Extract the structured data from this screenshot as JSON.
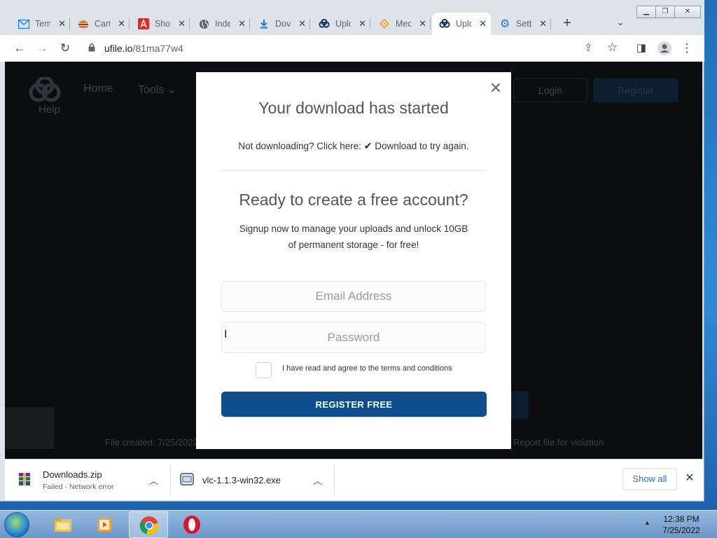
{
  "browser": {
    "tabs": [
      {
        "title": "Tem",
        "icon": "mail-icon"
      },
      {
        "title": "Cart",
        "icon": "burger-icon"
      },
      {
        "title": "Sho",
        "icon": "adobe-icon"
      },
      {
        "title": "Inde",
        "icon": "globe-icon"
      },
      {
        "title": "Dov",
        "icon": "download-icon"
      },
      {
        "title": "Uplo",
        "icon": "ufile-icon"
      },
      {
        "title": "Mec",
        "icon": "diamond-icon"
      },
      {
        "title": "Uplo",
        "icon": "ufile-icon",
        "active": true
      },
      {
        "title": "Setti",
        "icon": "gear-icon"
      }
    ],
    "url_host": "ufile.io",
    "url_path": "/81ma77w4"
  },
  "page_background": {
    "help": "Help",
    "home": "Home",
    "tools": "Tools ⌄",
    "login": "Login",
    "register": "Register",
    "file_created": "File created: 7/25/2022",
    "report": "Report file for violation"
  },
  "modal": {
    "title": "Your download has started",
    "retry_prefix": "Not downloading? Click here: ",
    "retry_link": "Download to try again.",
    "signup_title": "Ready to create a free account?",
    "signup_text": "Signup now to manage your uploads and unlock 10GB of permanent storage - for free!",
    "email_placeholder": "Email Address",
    "password_placeholder": "Password",
    "terms_label": "I have read and agree to the terms and conditions",
    "register_button": "REGISTER FREE"
  },
  "downloads": {
    "items": [
      {
        "name": "Downloads.zip",
        "status": "Failed - Network error",
        "icon": "winrar-icon"
      },
      {
        "name": "vlc-1.1.3-win32.exe",
        "status": "",
        "icon": "installer-icon"
      }
    ],
    "show_all": "Show all"
  },
  "taskbar": {
    "time": "12:38 PM",
    "date": "7/25/2022",
    "apps": [
      "file-explorer-icon",
      "media-player-icon",
      "chrome-icon",
      "opera-icon"
    ]
  },
  "colors": {
    "accent_button": "#0e4e8c",
    "link_blue": "#1a73e8"
  }
}
